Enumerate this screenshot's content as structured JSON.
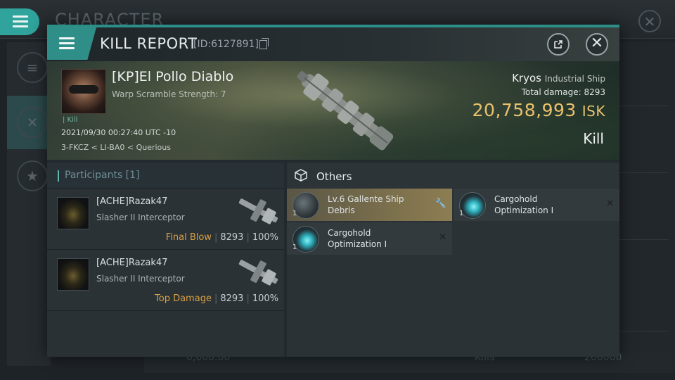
{
  "background": {
    "title": "CHARACTER",
    "close_label": "✕",
    "bottom_left_value": "0,000.00",
    "bottom_mid_value": "Kills",
    "bottom_right_value": "200000"
  },
  "modal": {
    "title": "KILL REPORT",
    "id": "[ID:6127891]"
  },
  "victim": {
    "name": "[KP]El Pollo Diablo",
    "warp_scramble": "Warp Scramble Strength: 7",
    "tag": "| Kill",
    "time": "2021/09/30 00:27:40 UTC -10",
    "location": "3-FKCZ < LI-BA0 < Querious"
  },
  "ship": {
    "name": "Kryos",
    "class": "Industrial Ship",
    "total_damage_label": "Total damage:",
    "total_damage": "8293",
    "isk_value": "20,758,993",
    "isk_unit": "ISK",
    "result": "Kill"
  },
  "participants": {
    "header": "Participants [1]",
    "rows": [
      {
        "name": "[ACHE]Razak47",
        "ship": "Slasher II Interceptor",
        "tag": "Final Blow",
        "damage": "8293",
        "percent": "100%"
      },
      {
        "name": "[ACHE]Razak47",
        "ship": "Slasher II Interceptor",
        "tag": "Top Damage",
        "damage": "8293",
        "percent": "100%"
      }
    ]
  },
  "others": {
    "header": "Others",
    "items": [
      {
        "qty": "1",
        "name": "Lv.6 Gallente Ship Debris",
        "action": "🔧"
      },
      {
        "qty": "1",
        "name": "Cargohold Optimization I",
        "action": "✕"
      },
      {
        "qty": "1",
        "name": "Cargohold Optimization I",
        "action": "✕"
      }
    ]
  }
}
